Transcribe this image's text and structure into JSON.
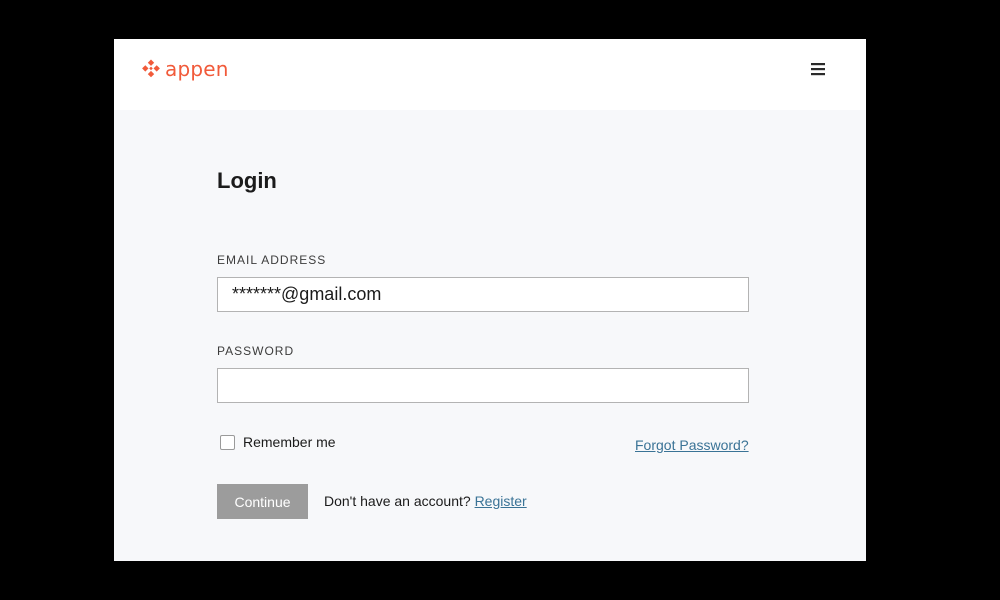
{
  "header": {
    "logo_text": "appen",
    "brand_color": "#f15a3a",
    "menu_icon": "hamburger-menu-icon"
  },
  "login": {
    "title": "Login",
    "email_label": "EMAIL ADDRESS",
    "email_value": "*******@gmail.com",
    "password_label": "PASSWORD",
    "password_value": "",
    "remember_label": "Remember me",
    "remember_checked": false,
    "forgot_label": "Forgot Password?",
    "continue_label": "Continue",
    "no_account_text": "Don't have an account?",
    "register_label": "Register",
    "link_color": "#3a7396",
    "button_color": "#9c9c9c"
  }
}
